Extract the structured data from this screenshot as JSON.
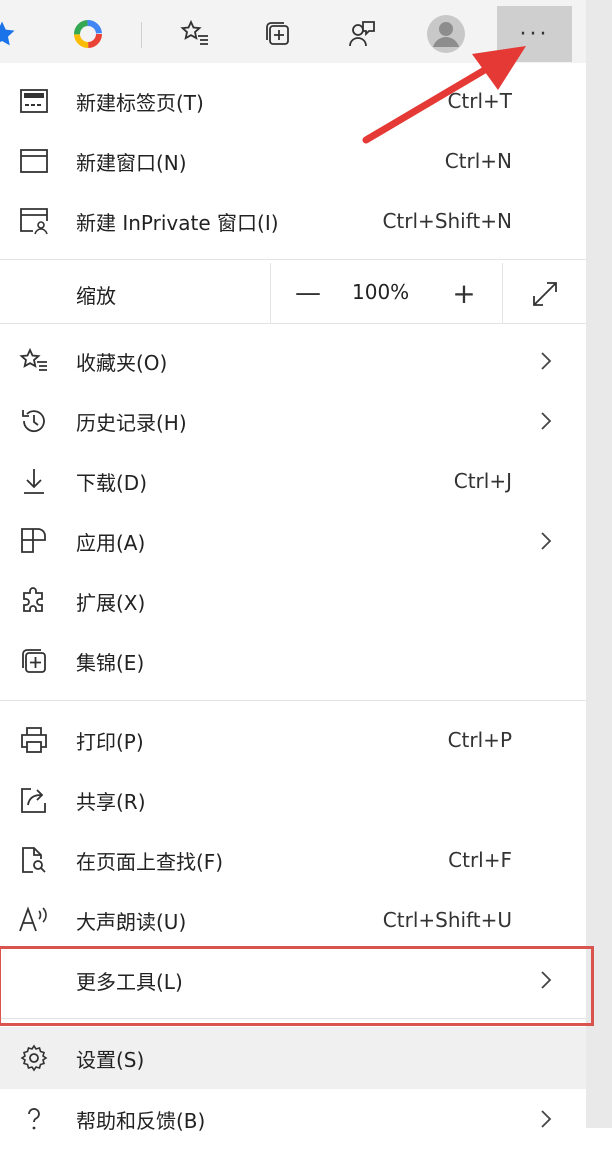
{
  "toolbar": {
    "icons": [
      "star-icon",
      "colored-ring-icon",
      "favorites-icon",
      "collections-icon",
      "feedback-icon",
      "profile-avatar"
    ],
    "more_label": "···"
  },
  "menu": {
    "new_tab": {
      "label": "新建标签页(T)",
      "shortcut": "Ctrl+T"
    },
    "new_window": {
      "label": "新建窗口(N)",
      "shortcut": "Ctrl+N"
    },
    "new_inprivate": {
      "label": "新建 InPrivate 窗口(I)",
      "shortcut": "Ctrl+Shift+N"
    },
    "zoom": {
      "label": "缩放",
      "minus": "—",
      "value": "100%",
      "plus": "+"
    },
    "favorites": {
      "label": "收藏夹(O)"
    },
    "history": {
      "label": "历史记录(H)"
    },
    "downloads": {
      "label": "下载(D)",
      "shortcut": "Ctrl+J"
    },
    "apps": {
      "label": "应用(A)"
    },
    "extensions": {
      "label": "扩展(X)"
    },
    "collections": {
      "label": "集锦(E)"
    },
    "print": {
      "label": "打印(P)",
      "shortcut": "Ctrl+P"
    },
    "share": {
      "label": "共享(R)"
    },
    "find": {
      "label": "在页面上查找(F)",
      "shortcut": "Ctrl+F"
    },
    "read_aloud": {
      "label": "大声朗读(U)",
      "shortcut": "Ctrl+Shift+U"
    },
    "more_tools": {
      "label": "更多工具(L)"
    },
    "settings": {
      "label": "设置(S)"
    },
    "help": {
      "label": "帮助和反馈(B)"
    }
  },
  "colors": {
    "highlight": "#d9534f",
    "arrow": "#e53935",
    "accent_blue": "#1a73e8"
  }
}
